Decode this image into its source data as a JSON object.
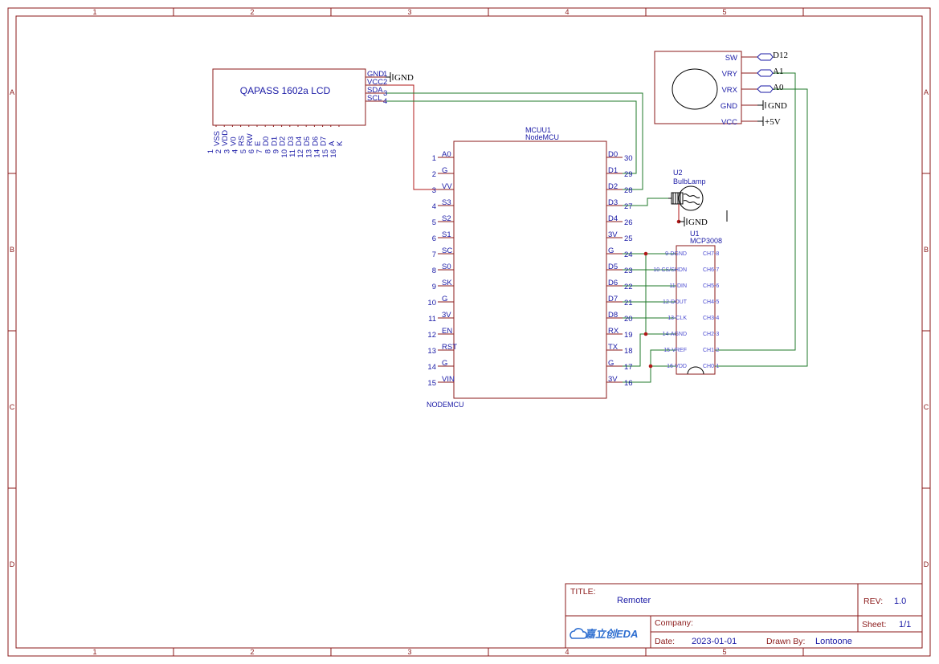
{
  "frame": {
    "columns": [
      "1",
      "2",
      "3",
      "4",
      "5"
    ],
    "rows": [
      "A",
      "B",
      "C",
      "D"
    ]
  },
  "lcd": {
    "title": "QAPASS 1602a LCD",
    "right_pins": [
      {
        "name": "GND",
        "num": "1"
      },
      {
        "name": "VCC",
        "num": "2"
      },
      {
        "name": "SDA",
        "num": "3"
      },
      {
        "name": "SCL",
        "num": "4"
      }
    ],
    "bottom_pins": [
      {
        "name": "VSS",
        "num": "1"
      },
      {
        "name": "VDD",
        "num": "2"
      },
      {
        "name": "V0",
        "num": "3"
      },
      {
        "name": "RS",
        "num": "4"
      },
      {
        "name": "RW",
        "num": "5"
      },
      {
        "name": "E",
        "num": "6"
      },
      {
        "name": "D0",
        "num": "7"
      },
      {
        "name": "D1",
        "num": "8"
      },
      {
        "name": "D2",
        "num": "9"
      },
      {
        "name": "D3",
        "num": "10"
      },
      {
        "name": "D4",
        "num": "11"
      },
      {
        "name": "D5",
        "num": "12"
      },
      {
        "name": "D6",
        "num": "13"
      },
      {
        "name": "D7",
        "num": "14"
      },
      {
        "name": "A",
        "num": "15"
      },
      {
        "name": "K",
        "num": "16"
      }
    ]
  },
  "nodemcu": {
    "ref": "MCUU1",
    "value": "NodeMCU",
    "footprint": "NODEMCU",
    "left_pins": [
      {
        "name": "A0",
        "num": "1"
      },
      {
        "name": "G",
        "num": "2"
      },
      {
        "name": "VV",
        "num": "3"
      },
      {
        "name": "S3",
        "num": "4"
      },
      {
        "name": "S2",
        "num": "5"
      },
      {
        "name": "S1",
        "num": "6"
      },
      {
        "name": "SC",
        "num": "7"
      },
      {
        "name": "S0",
        "num": "8"
      },
      {
        "name": "SK",
        "num": "9"
      },
      {
        "name": "G",
        "num": "10"
      },
      {
        "name": "3V",
        "num": "11"
      },
      {
        "name": "EN",
        "num": "12"
      },
      {
        "name": "RST",
        "num": "13"
      },
      {
        "name": "G",
        "num": "14"
      },
      {
        "name": "VIN",
        "num": "15"
      }
    ],
    "right_pins": [
      {
        "name": "D0",
        "num": "30"
      },
      {
        "name": "D1",
        "num": "29"
      },
      {
        "name": "D2",
        "num": "28"
      },
      {
        "name": "D3",
        "num": "27"
      },
      {
        "name": "D4",
        "num": "26"
      },
      {
        "name": "3V",
        "num": "25"
      },
      {
        "name": "G",
        "num": "24"
      },
      {
        "name": "D5",
        "num": "23"
      },
      {
        "name": "D6",
        "num": "22"
      },
      {
        "name": "D7",
        "num": "21"
      },
      {
        "name": "D8",
        "num": "20"
      },
      {
        "name": "RX",
        "num": "19"
      },
      {
        "name": "TX",
        "num": "18"
      },
      {
        "name": "G",
        "num": "17"
      },
      {
        "name": "3V",
        "num": "16"
      }
    ]
  },
  "joystick": {
    "pins": [
      "SW",
      "VRY",
      "VRX",
      "GND",
      "VCC"
    ],
    "nets": [
      "D12",
      "A1",
      "A0",
      "GND",
      "+5V"
    ]
  },
  "bulb": {
    "ref": "U2",
    "value": "BulbLamp",
    "gnd": "GND"
  },
  "mcp": {
    "ref": "U1",
    "value": "MCP3008",
    "left_pins": [
      "9-DGND",
      "10-CS/SHDN",
      "11-DIN",
      "12-DOUT",
      "13-CLK",
      "14-AGND",
      "15-VREF",
      "16-VDD"
    ],
    "right_pins": [
      "CH7-8",
      "CH6-7",
      "CH5-6",
      "CH4-5",
      "CH3-4",
      "CH2-3",
      "CH1-2",
      "CH0-1"
    ]
  },
  "lcd_gnd": "GND",
  "title_block": {
    "title_label": "TITLE:",
    "title": "Remoter",
    "rev_label": "REV:",
    "rev": "1.0",
    "company_label": "Company:",
    "company": "",
    "sheet_label": "Sheet:",
    "sheet": "1/1",
    "date_label": "Date:",
    "date": "2023-01-01",
    "drawn_label": "Drawn By:",
    "drawn_by": "Lontoone",
    "logo_text": "嘉立创EDA"
  }
}
